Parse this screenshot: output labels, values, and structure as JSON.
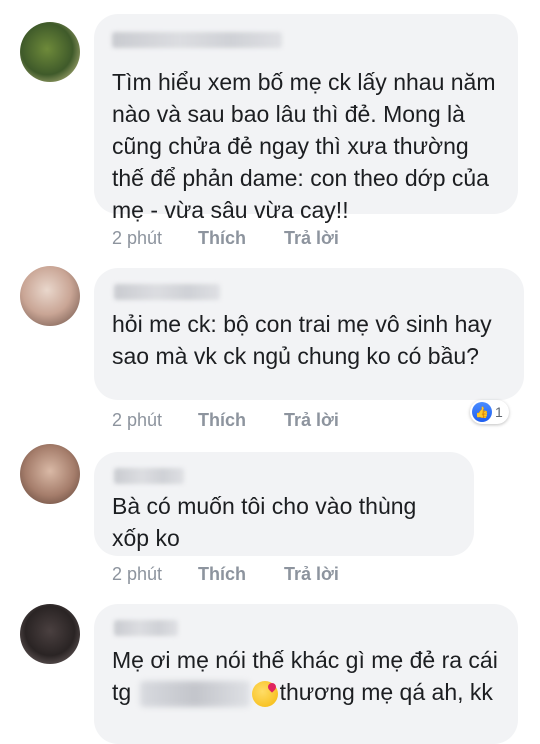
{
  "comments": [
    {
      "text": "Tìm hiểu xem bố mẹ ck lấy nhau năm nào và sau bao lâu thì đẻ. Mong là cũng chửa đẻ ngay thì xưa thường thế để phản dame: con theo dớp của mẹ - vừa sâu vừa cay!!",
      "time": "2 phút",
      "like": "Thích",
      "reply": "Trả lời"
    },
    {
      "text": "hỏi me ck: bộ con trai mẹ vô sinh hay sao mà vk ck ngủ chung ko có bầu?",
      "time": "2 phút",
      "like": "Thích",
      "reply": "Trả lời",
      "reaction_count": "1"
    },
    {
      "text": "Bà có muốn tôi cho vào thùng xốp ko",
      "time": "2 phút",
      "like": "Thích",
      "reply": "Trả lời"
    },
    {
      "text_before": "Mẹ ơi mẹ nói thế khác gì mẹ đẻ ra cái tg",
      "text_after": "thương mẹ qá ah, kk"
    }
  ]
}
